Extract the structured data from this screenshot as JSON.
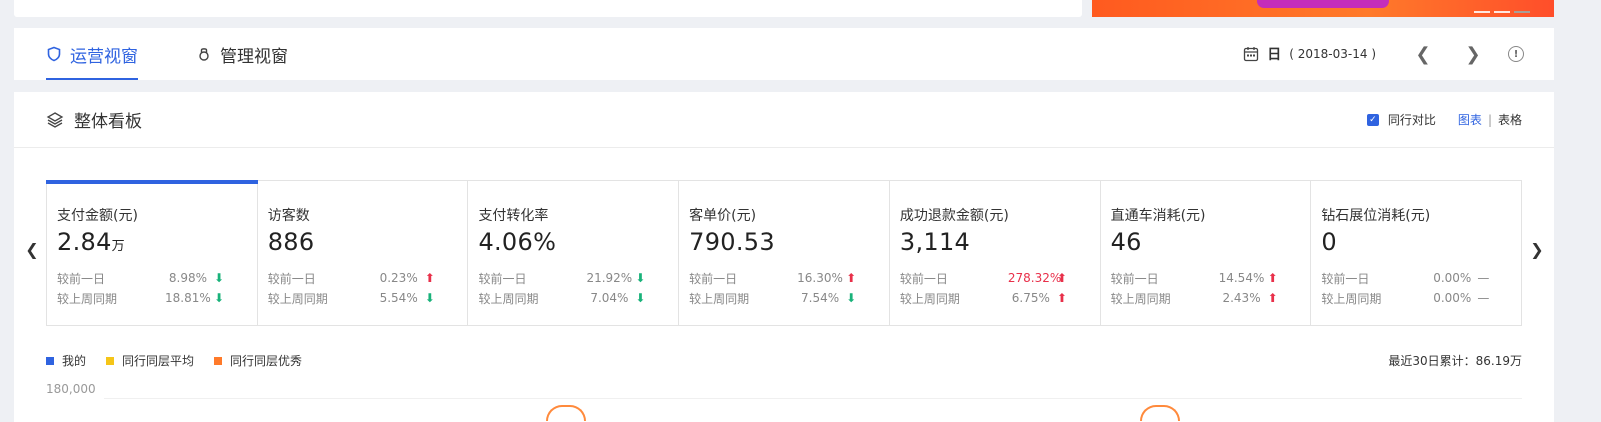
{
  "tabs": [
    {
      "label": "运营视窗",
      "icon": "shield-icon",
      "active": true
    },
    {
      "label": "管理视窗",
      "icon": "lock-icon",
      "active": false
    }
  ],
  "date": {
    "prefix": "日",
    "value": "( 2018-03-14 )"
  },
  "panel": {
    "title": "整体看板",
    "compare_label": "同行对比",
    "view_chart": "图表",
    "view_table": "表格",
    "separator": "|"
  },
  "metrics": [
    {
      "name": "支付金额(元)",
      "value": "2.84",
      "unit": "万",
      "rows": [
        {
          "label": "较前一日",
          "pct": "8.98%",
          "trend": "down"
        },
        {
          "label": "较上周同期",
          "pct": "18.81%",
          "trend": "down"
        }
      ]
    },
    {
      "name": "访客数",
      "value": "886",
      "unit": "",
      "rows": [
        {
          "label": "较前一日",
          "pct": "0.23%",
          "trend": "up"
        },
        {
          "label": "较上周同期",
          "pct": "5.54%",
          "trend": "down"
        }
      ]
    },
    {
      "name": "支付转化率",
      "value": "4.06%",
      "unit": "",
      "rows": [
        {
          "label": "较前一日",
          "pct": "21.92%",
          "trend": "down"
        },
        {
          "label": "较上周同期",
          "pct": "7.04%",
          "trend": "down"
        }
      ]
    },
    {
      "name": "客单价(元)",
      "value": "790.53",
      "unit": "",
      "rows": [
        {
          "label": "较前一日",
          "pct": "16.30%",
          "trend": "up"
        },
        {
          "label": "较上周同期",
          "pct": "7.54%",
          "trend": "down"
        }
      ]
    },
    {
      "name": "成功退款金额(元)",
      "value": "3,114",
      "unit": "",
      "rows": [
        {
          "label": "较前一日",
          "pct": "278.32%",
          "trend": "up",
          "hot": true
        },
        {
          "label": "较上周同期",
          "pct": "6.75%",
          "trend": "up"
        }
      ]
    },
    {
      "name": "直通车消耗(元)",
      "value": "46",
      "unit": "",
      "rows": [
        {
          "label": "较前一日",
          "pct": "14.54%",
          "trend": "up"
        },
        {
          "label": "较上周同期",
          "pct": "2.43%",
          "trend": "up"
        }
      ]
    },
    {
      "name": "钻石展位消耗(元)",
      "value": "0",
      "unit": "",
      "rows": [
        {
          "label": "较前一日",
          "pct": "0.00%",
          "trend": "flat"
        },
        {
          "label": "较上周同期",
          "pct": "0.00%",
          "trend": "flat"
        }
      ]
    }
  ],
  "legend": [
    {
      "label": "我的",
      "color": "#2f63e0"
    },
    {
      "label": "同行同层平均",
      "color": "#f5c518"
    },
    {
      "label": "同行同层优秀",
      "color": "#ff7a2a"
    }
  ],
  "cumulative": "最近30日累计：86.19万",
  "y_top_tick": "180,000",
  "colors": {
    "accent": "#2f63e0",
    "up": "#e8304a",
    "down": "#19b27a"
  }
}
